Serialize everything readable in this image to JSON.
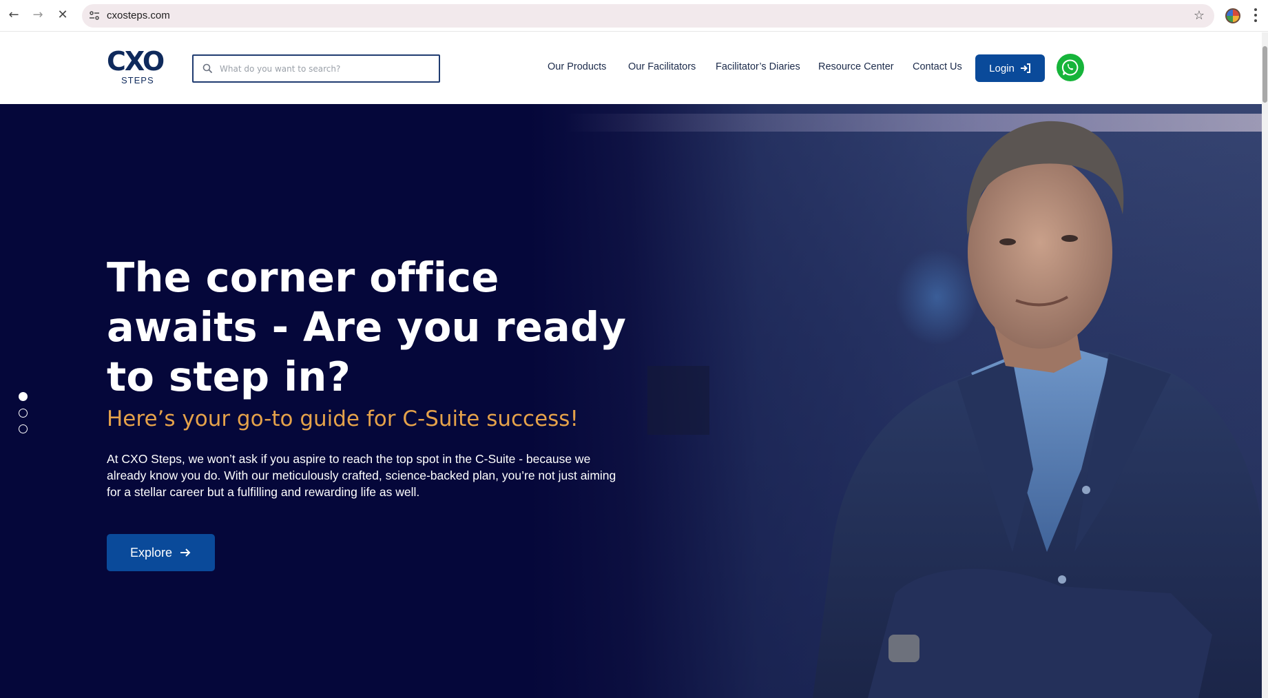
{
  "browser": {
    "url": "cxosteps.com"
  },
  "header": {
    "logo_mark": "CXO",
    "logo_sub": "STEPS",
    "search": {
      "placeholder": "What do you want to search?"
    },
    "menu": [
      {
        "label": "Our Products"
      },
      {
        "label": "Our Facilitators"
      },
      {
        "label": "Facilitator’s Diaries"
      },
      {
        "label": "Resource Center"
      },
      {
        "label": "Contact Us"
      }
    ],
    "login_label": "Login"
  },
  "hero": {
    "title": "The corner office awaits - Are you ready to step in?",
    "subtitle": "Here’s your go-to guide for C-Suite success!",
    "body": "At CXO Steps, we won’t ask if you aspire to reach the top spot in the C-Suite - because we already know you do. With our meticulously crafted, science-backed plan, you’re not just aiming for a stellar career but a fulfilling and rewarding life as well.",
    "cta_label": "Explore",
    "slides": {
      "count": 3,
      "active": 1
    }
  },
  "colors": {
    "brand_blue": "#0a4a9a",
    "hero_bg": "#07093a",
    "accent_gold": "#e5a24a",
    "whatsapp_green": "#16b43a"
  }
}
